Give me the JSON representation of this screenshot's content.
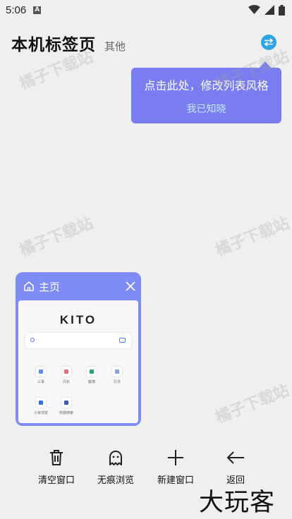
{
  "status_bar": {
    "time": "5:06",
    "notification_icon": "A",
    "icons": [
      "wifi-icon",
      "signal-icon",
      "battery-icon"
    ]
  },
  "header": {
    "title": "本机标签页",
    "other_label": "其他",
    "switch_icon": "swap-arrows-icon"
  },
  "tooltip": {
    "message": "点击此处，修改列表风格",
    "ack_label": "我已知晓"
  },
  "tab_card": {
    "title": "主页",
    "preview": {
      "logo": "KITO",
      "shortcuts": [
        {
          "label": "三事",
          "color": "#5a8ef0"
        },
        {
          "label": "闪长",
          "color": "#e86a7a"
        },
        {
          "label": "都荡",
          "color": "#2aa66a"
        },
        {
          "label": "行沃",
          "color": "#8aa0d8"
        },
        {
          "label": "小米浏览",
          "color": "#2f72e8"
        },
        {
          "label": "你猜搜索",
          "color": "#3a5ab8"
        }
      ]
    }
  },
  "toolbar": {
    "items": [
      {
        "label": "清空窗口",
        "icon": "trash-icon"
      },
      {
        "label": "无痕浏览",
        "icon": "ghost-icon"
      },
      {
        "label": "新建窗口",
        "icon": "plus-icon"
      },
      {
        "label": "返回",
        "icon": "arrow-left-icon"
      }
    ]
  },
  "watermark": "橘子下载站",
  "brand_mark": "大玩客",
  "colors": {
    "accent": "#7a7df0",
    "card": "#7f8cf5",
    "switch_button": "#2fa6e4",
    "background": "#efefef"
  }
}
